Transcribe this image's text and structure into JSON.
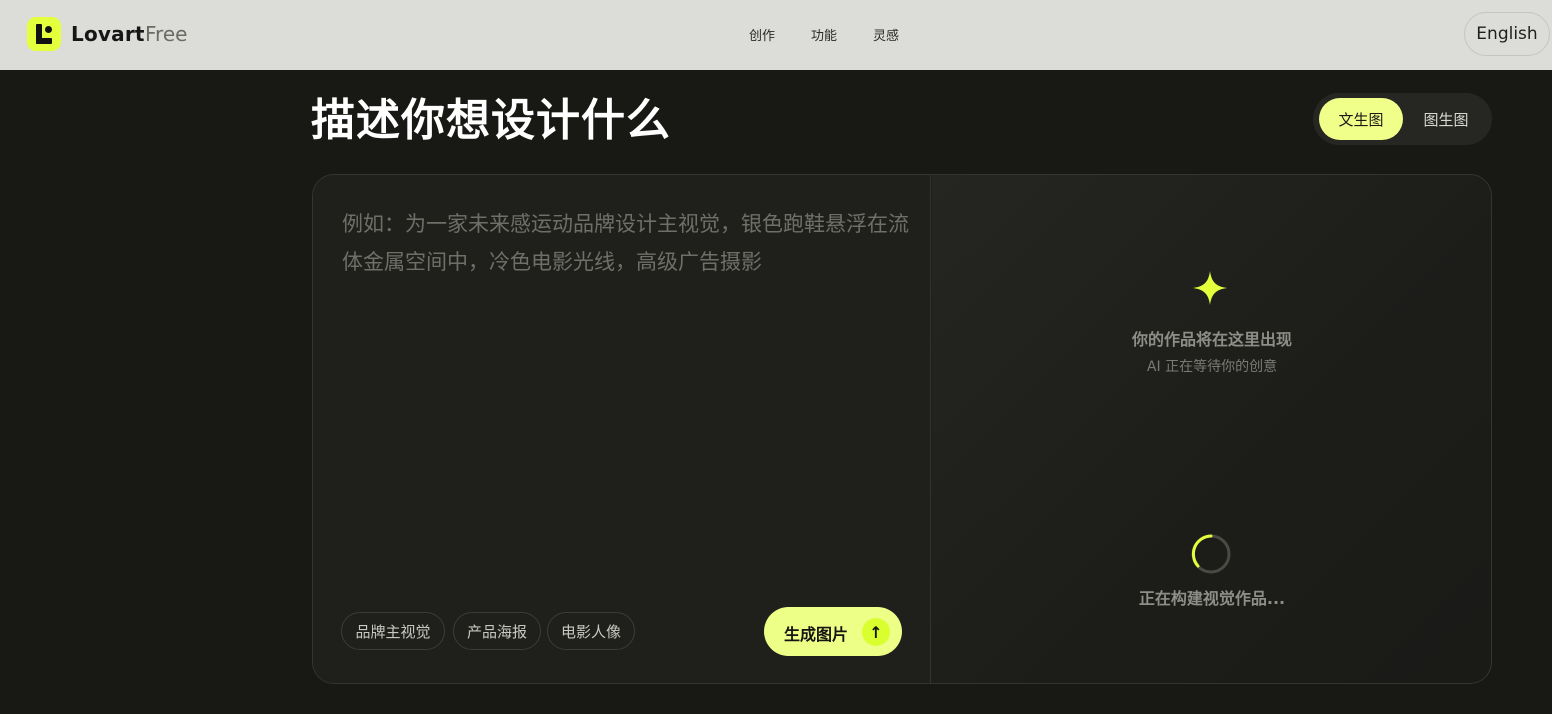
{
  "header": {
    "brand": "Lovart",
    "plan": "Free",
    "nav": [
      "创作",
      "功能",
      "灵感"
    ],
    "language": "English"
  },
  "page": {
    "title": "描述你想设计什么",
    "modes": [
      "文生图",
      "图生图"
    ],
    "active_mode": "文生图"
  },
  "prompt": {
    "placeholder": "例如：为一家未来感运动品牌设计主视觉，银色跑鞋悬浮在流体金属空间中，冷色电影光线，高级广告摄影",
    "value": ""
  },
  "chips": [
    "品牌主视觉",
    "产品海报",
    "电影人像"
  ],
  "generate": {
    "label": "生成图片",
    "icon": "arrow-up-icon",
    "arrow": "↑"
  },
  "preview": {
    "icon": "sparkle-icon",
    "title": "你的作品将在这里出现",
    "subtitle": "AI 正在等待你的创意",
    "loading": "正在构建视觉作品..."
  },
  "colors": {
    "accent": "#e4ff3c",
    "accent_soft": "#f0ff8a",
    "background": "#181814",
    "topbar": "#dcdcd8"
  }
}
